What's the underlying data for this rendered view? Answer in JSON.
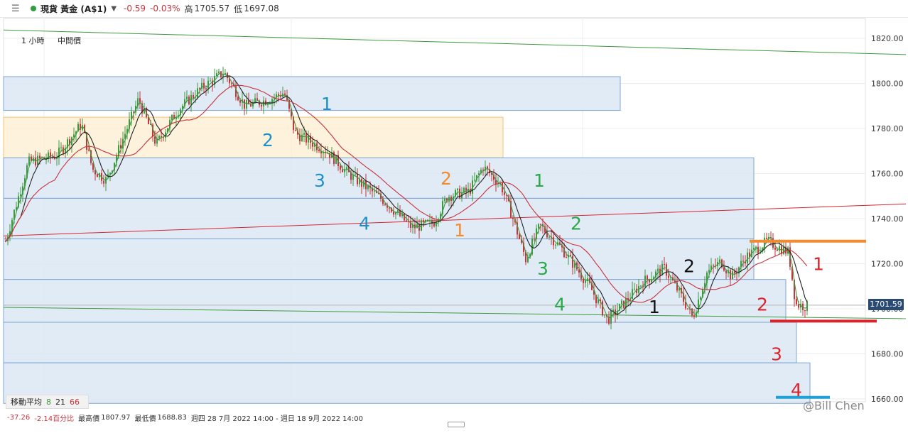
{
  "header": {
    "symbol": "現貨 黃金 (A$1)",
    "change": "-0.59",
    "change_pct": "-0.03%",
    "high_label": "高",
    "high": "1705.57",
    "low_label": "低",
    "low": "1697.08"
  },
  "chart_controls": {
    "timeframe": "1 小時",
    "price_type": "中間價"
  },
  "ma_legend": {
    "label": "移動平均",
    "p1": "8",
    "p2": "21",
    "p3": "66",
    "colors": {
      "p1": "#3e9a3e",
      "p2": "#222222",
      "p3": "#c8323a"
    }
  },
  "stats": {
    "abs_change": "-37.26",
    "pct_change": "-2.14百分比",
    "max_label": "最高價",
    "max": "1807.97",
    "min_label": "最低價",
    "min": "1688.83",
    "range": "週四 28 7月 2022 14:00 - 週日 18 9月 2022 14:00"
  },
  "last_price": "1701.59",
  "watermark": "@Bill Chen",
  "chart_data": {
    "type": "candlestick",
    "y_ticks": [
      "1820.00",
      "1800.00",
      "1780.00",
      "1760.00",
      "1740.00",
      "1720.00",
      "1700.00",
      "1680.00",
      "1660.00"
    ],
    "ylim": [
      1656,
      1829
    ],
    "annotations": [
      {
        "text": "1",
        "price": 1791,
        "col": "#1e8fc8"
      },
      {
        "text": "2",
        "price": 1775,
        "col": "#1e8fc8"
      },
      {
        "text": "3",
        "price": 1757,
        "col": "#1e8fc8"
      },
      {
        "text": "4",
        "price": 1738,
        "col": "#1e8fc8"
      },
      {
        "text": "2",
        "price": 1758,
        "col": "#f28a2e"
      },
      {
        "text": "1",
        "price": 1735,
        "col": "#f28a2e"
      },
      {
        "text": "1",
        "price": 1757,
        "col": "#2aa84a"
      },
      {
        "text": "2",
        "price": 1738,
        "col": "#2aa84a"
      },
      {
        "text": "3",
        "price": 1718,
        "col": "#2aa84a"
      },
      {
        "text": "4",
        "price": 1702,
        "col": "#2aa84a"
      },
      {
        "text": "1",
        "price": 1701,
        "col": "#111111"
      },
      {
        "text": "2",
        "price": 1719,
        "col": "#111111"
      },
      {
        "text": "1",
        "price": 1720,
        "col": "#d9242c"
      },
      {
        "text": "2",
        "price": 1702,
        "col": "#d9242c"
      },
      {
        "text": "3",
        "price": 1680,
        "col": "#d9242c"
      },
      {
        "text": "4",
        "price": 1664,
        "col": "#d9242c"
      }
    ],
    "colors": {
      "up": "#3e9a3e",
      "down": "#c8323a",
      "zone_blue": "#dbe7f5",
      "zone_border": "#7fa6d2",
      "zone_orange": "#fdf0d6",
      "zone_orange_border": "#f2c27a",
      "line_orange": "#f28a2e",
      "line_red": "#d9242c",
      "line_cyan": "#1ea0d8",
      "grid": "#ececec",
      "trend_green": "#3e9a3e",
      "trend_red": "#d9242c"
    }
  }
}
